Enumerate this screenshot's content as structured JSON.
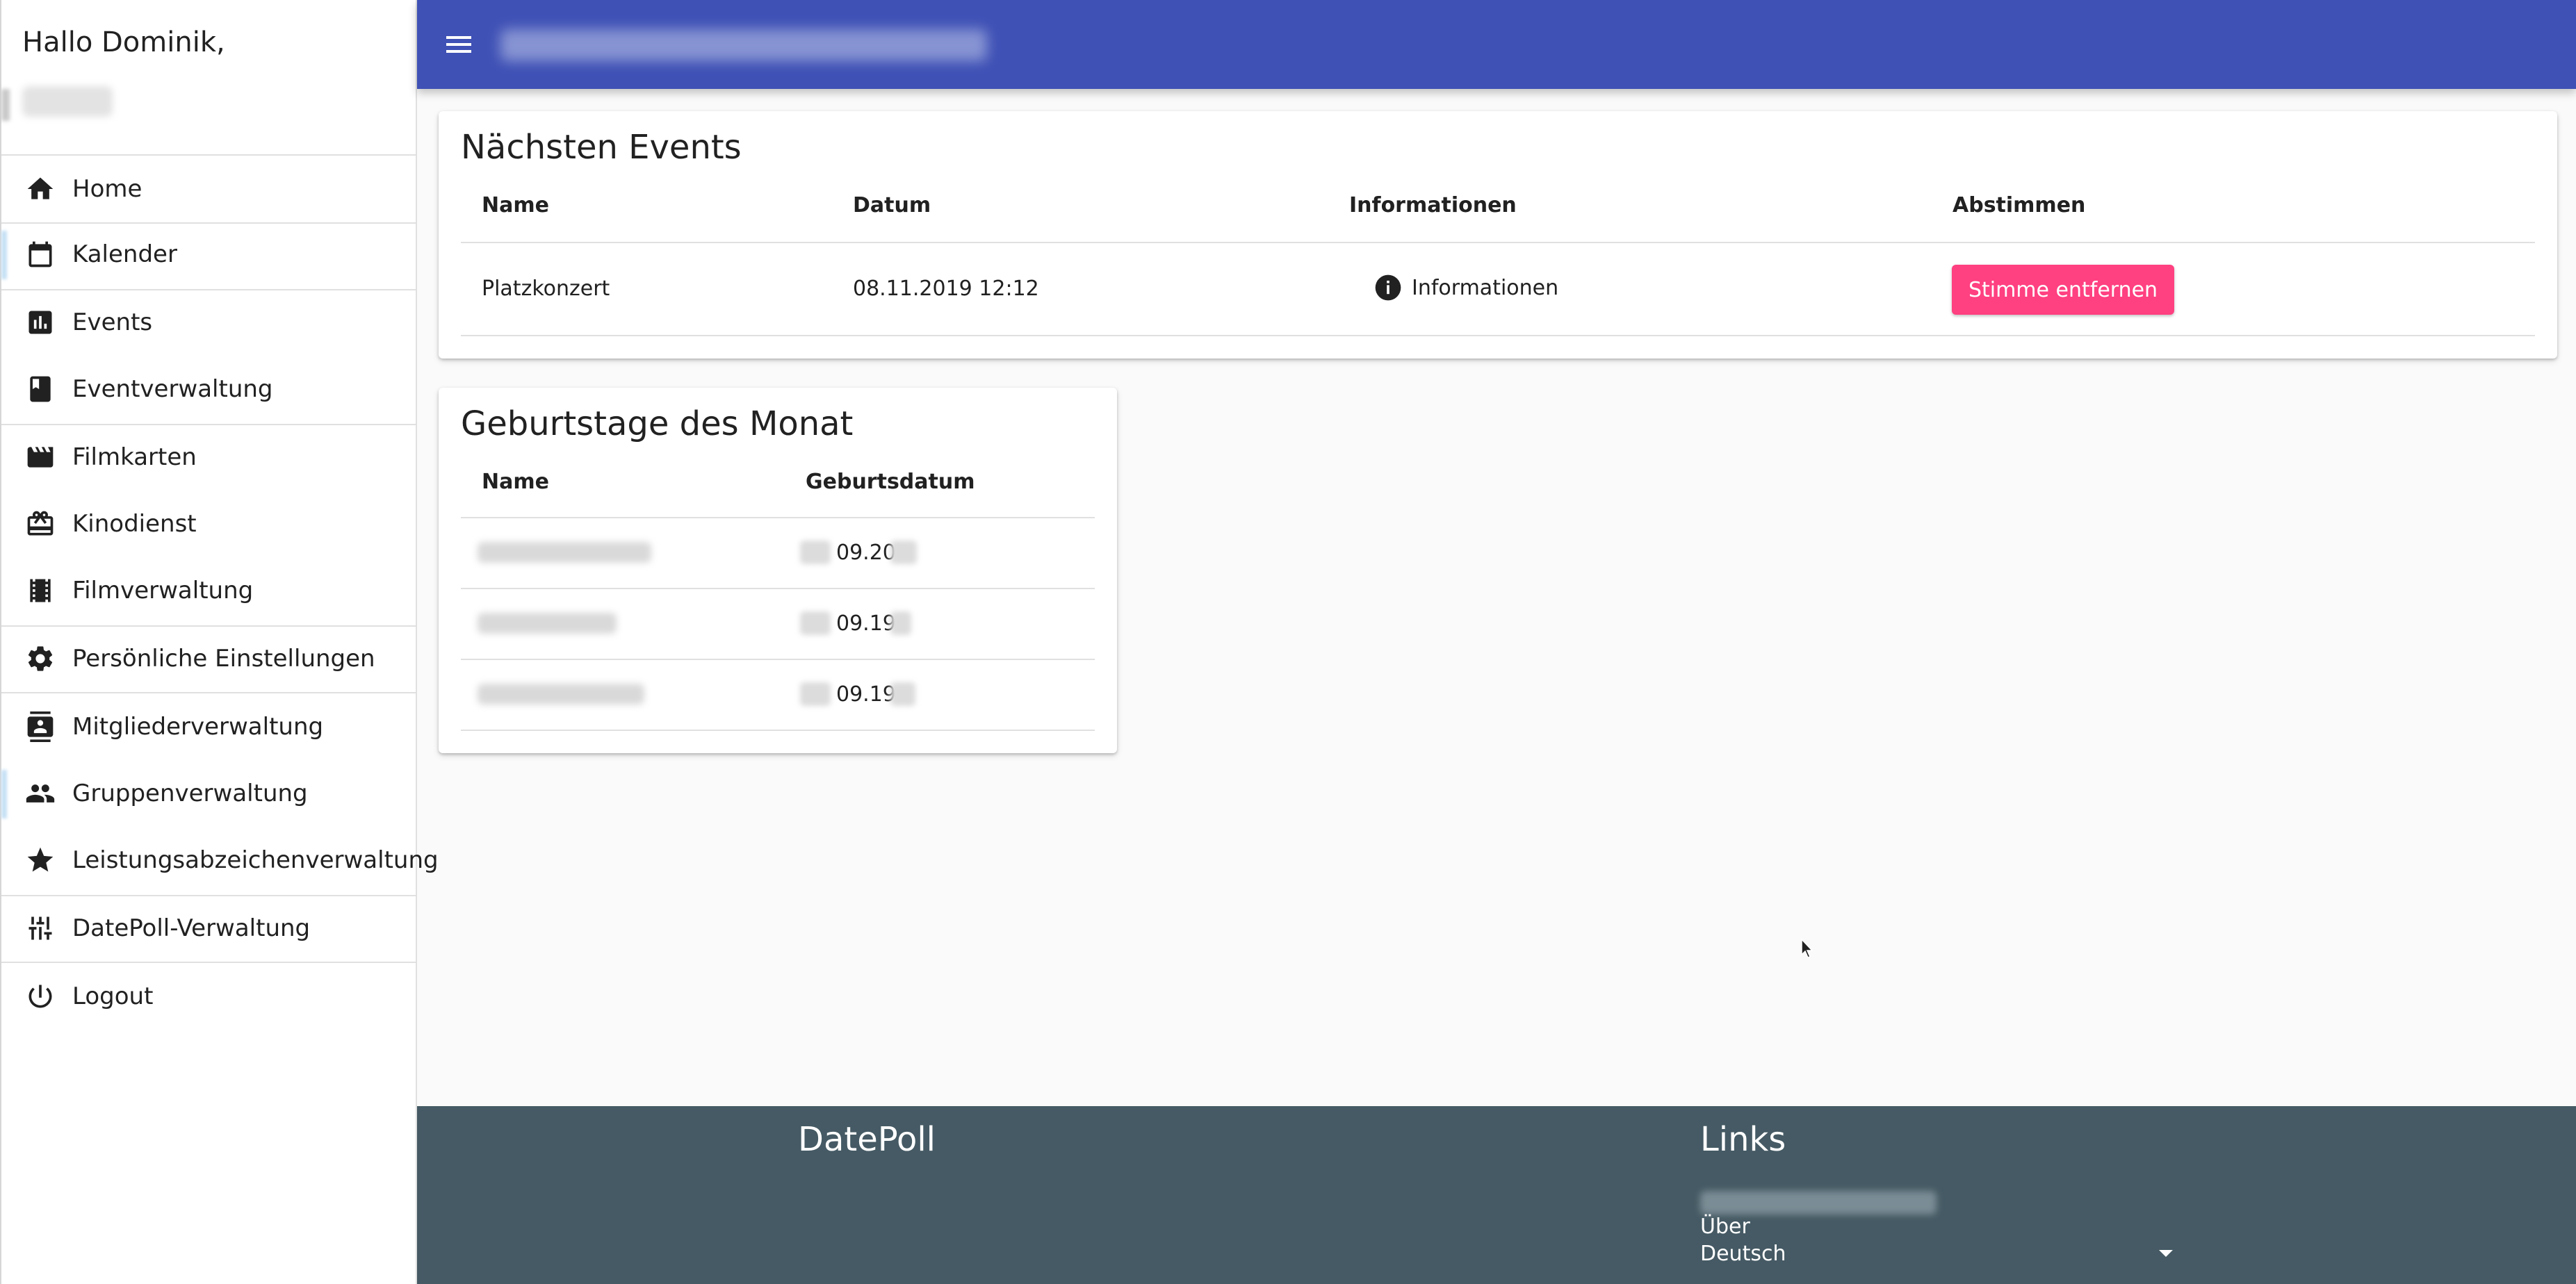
{
  "sidebar": {
    "greeting": "Hallo Dominik,",
    "items": [
      {
        "label": "Home",
        "icon": "home-icon"
      },
      {
        "label": "Kalender",
        "icon": "calendar-icon"
      },
      {
        "label": "Events",
        "icon": "bar-chart-icon"
      },
      {
        "label": "Eventverwaltung",
        "icon": "book-icon"
      },
      {
        "label": "Filmkarten",
        "icon": "clapperboard-icon"
      },
      {
        "label": "Kinodienst",
        "icon": "card-giftcard-icon"
      },
      {
        "label": "Filmverwaltung",
        "icon": "film-strip-icon"
      },
      {
        "label": "Persönliche Einstellungen",
        "icon": "gear-icon"
      },
      {
        "label": "Mitgliederverwaltung",
        "icon": "contacts-icon"
      },
      {
        "label": "Gruppenverwaltung",
        "icon": "people-icon"
      },
      {
        "label": "Leistungsabzeichenverwaltung",
        "icon": "star-icon"
      },
      {
        "label": "DatePoll-Verwaltung",
        "icon": "tune-icon"
      },
      {
        "label": "Logout",
        "icon": "power-icon"
      }
    ]
  },
  "colors": {
    "primary": "#3f51b5",
    "accent": "#ff4081",
    "footer": "#455a64"
  },
  "events": {
    "title": "Nächsten Events",
    "columns": [
      "Name",
      "Datum",
      "Informationen",
      "Abstimmen"
    ],
    "rows": [
      {
        "name": "Platzkonzert",
        "date": "08.11.2019 12:12",
        "info_label": "Informationen",
        "vote_label": "Stimme entfernen"
      }
    ]
  },
  "birthdays": {
    "title": "Geburtstage des Monat",
    "columns": [
      "Name",
      "Geburtsdatum"
    ],
    "rows": [
      {
        "date_visible": "09.20"
      },
      {
        "date_visible": "09.19"
      },
      {
        "date_visible": "09.19"
      }
    ]
  },
  "footer": {
    "brand": "DatePoll",
    "links_title": "Links",
    "about_label": "Über",
    "language": "Deutsch"
  }
}
